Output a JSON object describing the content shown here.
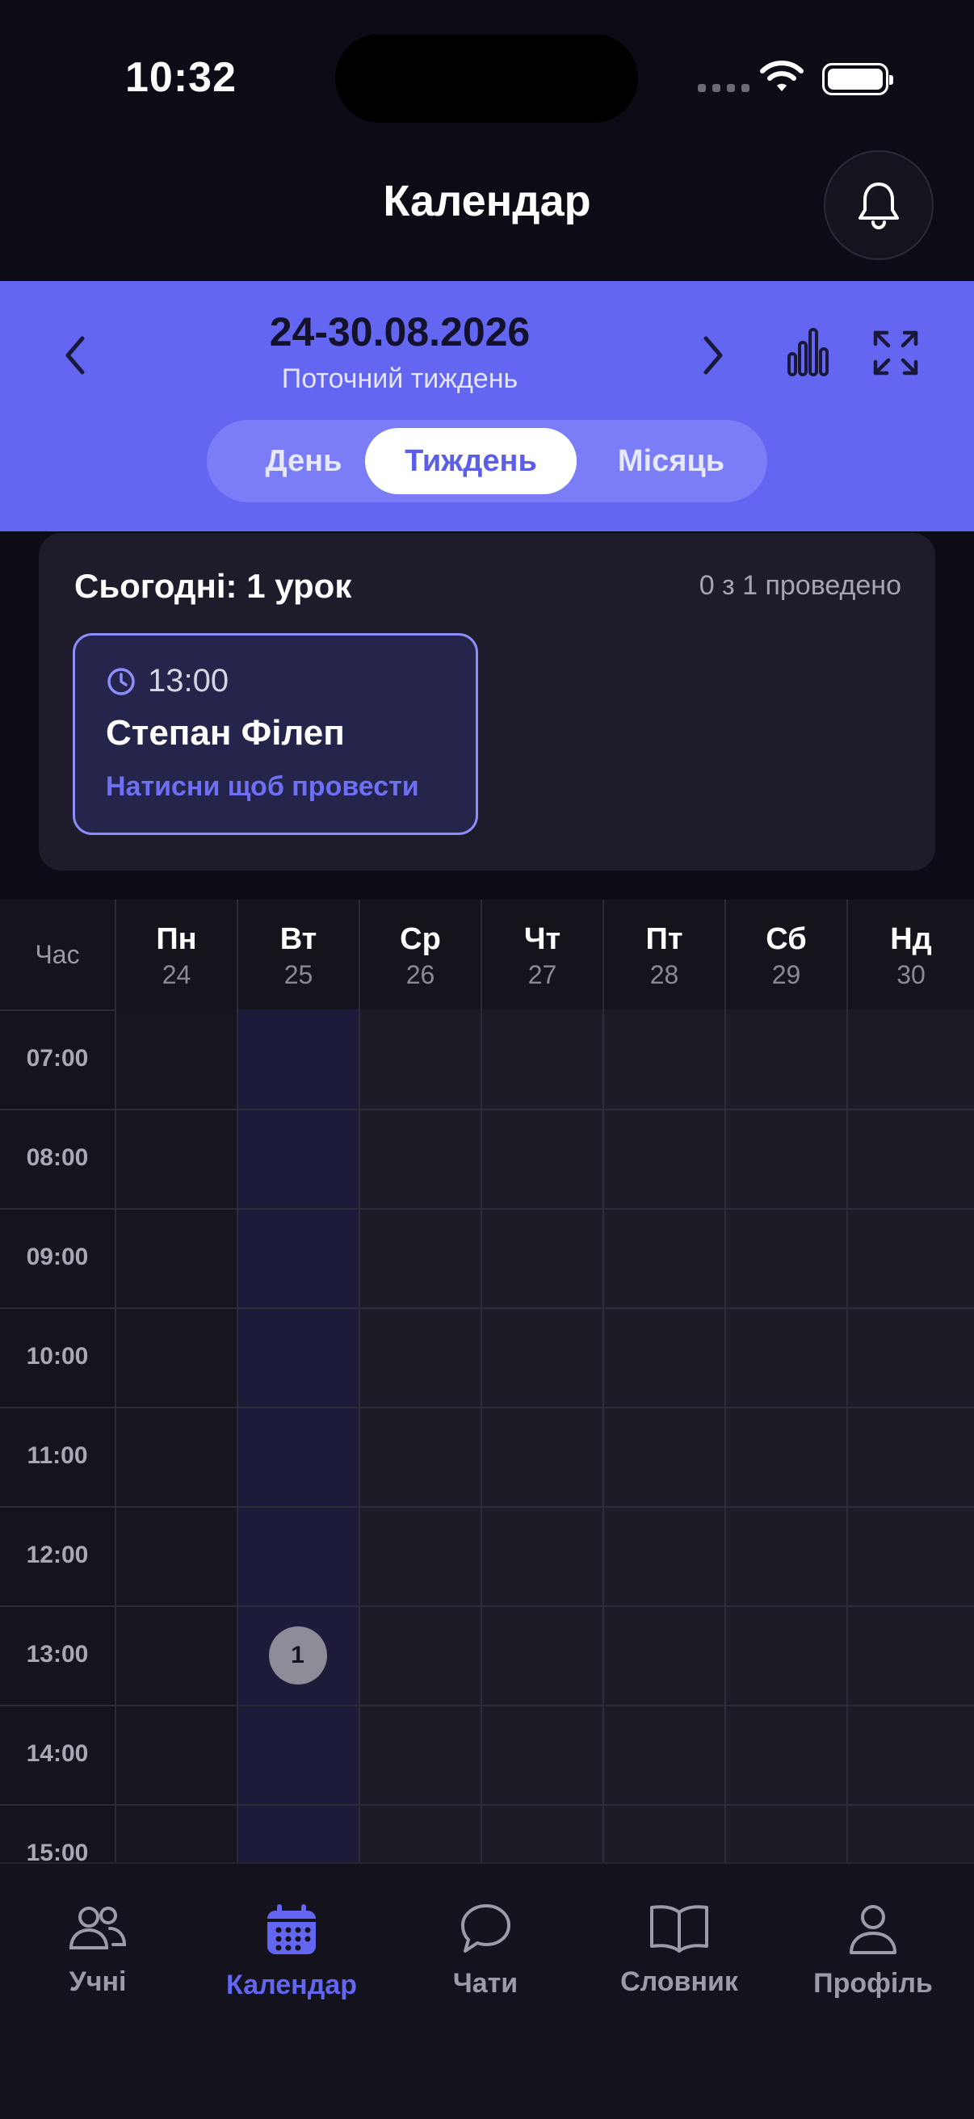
{
  "status_bar": {
    "time": "10:32"
  },
  "header": {
    "title": "Календар"
  },
  "week": {
    "range": "24-30.08.2026",
    "subtitle": "Поточний тиждень",
    "view_modes": [
      "День",
      "Тиждень",
      "Місяць"
    ],
    "active_mode": "Тиждень"
  },
  "today": {
    "title": "Сьогодні: 1 урок",
    "progress": "0 з 1 проведено",
    "lesson": {
      "time": "13:00",
      "student": "Степан Філеп",
      "hint": "Натисни щоб провести"
    }
  },
  "calendar": {
    "hour_header": "Час",
    "days": [
      {
        "name": "Пн",
        "date": "24"
      },
      {
        "name": "Вт",
        "date": "25"
      },
      {
        "name": "Ср",
        "date": "26"
      },
      {
        "name": "Чт",
        "date": "27"
      },
      {
        "name": "Пт",
        "date": "28"
      },
      {
        "name": "Сб",
        "date": "29"
      },
      {
        "name": "Нд",
        "date": "30"
      }
    ],
    "hours": [
      "07:00",
      "08:00",
      "09:00",
      "10:00",
      "11:00",
      "12:00",
      "13:00",
      "14:00",
      "15:00"
    ],
    "events": [
      {
        "day": "Вт",
        "hour": "13:00",
        "count": "1"
      }
    ],
    "highlighted_day": "Вт"
  },
  "tabbar": {
    "items": [
      {
        "label": "Учні",
        "icon": "users-icon"
      },
      {
        "label": "Календар",
        "icon": "calendar-icon"
      },
      {
        "label": "Чати",
        "icon": "chat-icon"
      },
      {
        "label": "Словник",
        "icon": "book-icon"
      },
      {
        "label": "Профіль",
        "icon": "profile-icon"
      }
    ],
    "active": "Календар"
  },
  "colors": {
    "accent": "#6366f1",
    "background": "#0d0c16",
    "card": "#1e1c2a",
    "highlight_column": "#1c1b3a"
  }
}
